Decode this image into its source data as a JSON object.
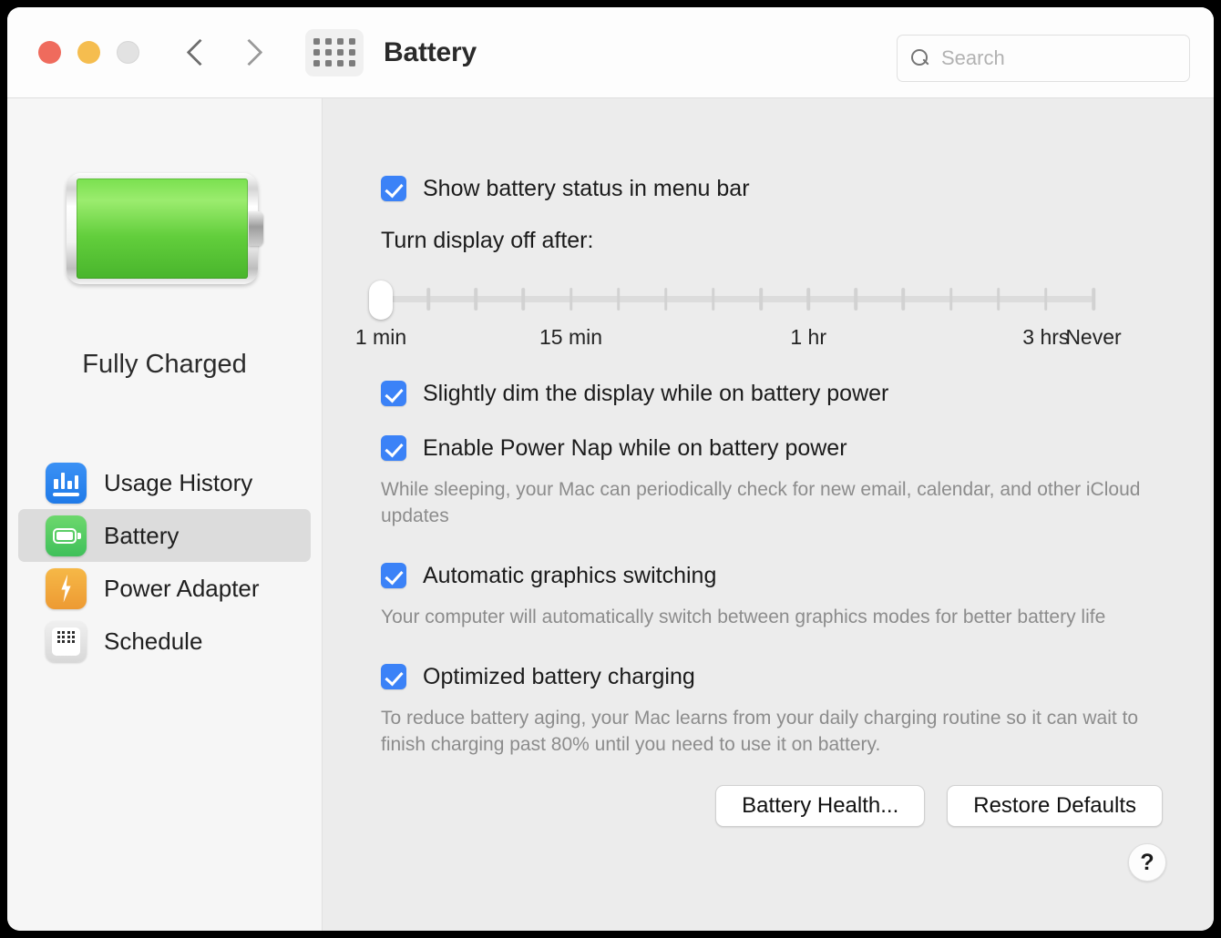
{
  "window": {
    "title": "Battery",
    "traffic_lights": [
      "close",
      "minimize",
      "zoom"
    ],
    "back_label": "Back",
    "forward_label": "Forward",
    "grid_label": "Show All"
  },
  "search": {
    "value": "",
    "placeholder": "Search"
  },
  "sidebar": {
    "battery_status": "Fully Charged",
    "items": [
      {
        "label": "Usage History",
        "icon": "usage-history-icon",
        "selected": false
      },
      {
        "label": "Battery",
        "icon": "battery-icon",
        "selected": true
      },
      {
        "label": "Power Adapter",
        "icon": "power-adapter-icon",
        "selected": false
      },
      {
        "label": "Schedule",
        "icon": "schedule-icon",
        "selected": false
      }
    ]
  },
  "main": {
    "show_status": {
      "label": "Show battery status in menu bar",
      "checked": true
    },
    "display_off": {
      "label": "Turn display off after:",
      "slider": {
        "value_index": 1,
        "tick_count": 16,
        "labels": [
          {
            "text": "1 min",
            "pos": 1
          },
          {
            "text": "15 min",
            "pos": 5
          },
          {
            "text": "1 hr",
            "pos": 10
          },
          {
            "text": "3 hrs",
            "pos": 15
          },
          {
            "text": "Never",
            "pos": 16
          }
        ]
      }
    },
    "dim_display": {
      "label": "Slightly dim the display while on battery power",
      "checked": true
    },
    "power_nap": {
      "label": "Enable Power Nap while on battery power",
      "checked": true,
      "help": "While sleeping, your Mac can periodically check for new email, calendar, and other iCloud updates"
    },
    "graphics_switching": {
      "label": "Automatic graphics switching",
      "checked": true,
      "help": "Your computer will automatically switch between graphics modes for better battery life"
    },
    "optimized_charging": {
      "label": "Optimized battery charging",
      "checked": true,
      "help": "To reduce battery aging, your Mac learns from your daily charging routine so it can wait to finish charging past 80% until you need to use it on battery."
    },
    "buttons": {
      "battery_health": "Battery Health...",
      "restore_defaults": "Restore Defaults",
      "help": "?"
    }
  },
  "colors": {
    "accent": "#3b82f7",
    "battery_green": "#62ce3c",
    "sidebar_bg": "#f6f6f6",
    "main_bg": "#ececec",
    "toolbar_bg": "#fdfdfd",
    "selected_row": "#dcdcdc",
    "help_text": "#8c8c8c"
  }
}
